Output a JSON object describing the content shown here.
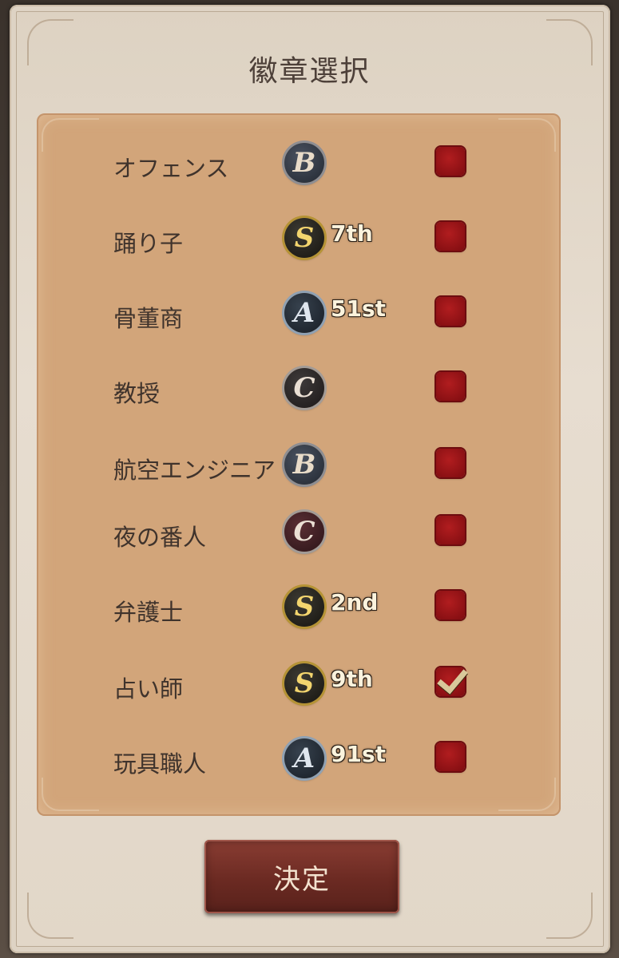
{
  "dialog": {
    "title": "徽章選択",
    "confirm_label": "決定"
  },
  "rows": [
    {
      "label": "オフェンス",
      "badge": "B",
      "badge_tier": "b",
      "rank": "",
      "checked": false
    },
    {
      "label": "踊り子",
      "badge": "S",
      "badge_tier": "s",
      "rank": "7th",
      "checked": false
    },
    {
      "label": "骨董商",
      "badge": "A",
      "badge_tier": "a",
      "rank": "51st",
      "checked": false
    },
    {
      "label": "教授",
      "badge": "C",
      "badge_tier": "c",
      "rank": "",
      "checked": false
    },
    {
      "label": "航空エンジニア",
      "badge": "B",
      "badge_tier": "b",
      "rank": "",
      "checked": false
    },
    {
      "label": "夜の番人",
      "badge": "C",
      "badge_tier": "c-red",
      "rank": "",
      "checked": false
    },
    {
      "label": "弁護士",
      "badge": "S",
      "badge_tier": "s",
      "rank": "2nd",
      "checked": false
    },
    {
      "label": "占い師",
      "badge": "S",
      "badge_tier": "s",
      "rank": "9th",
      "checked": true
    },
    {
      "label": "玩具職人",
      "badge": "A",
      "badge_tier": "a",
      "rank": "91st",
      "checked": false
    }
  ],
  "colors": {
    "panel": "#d2a57a",
    "checkbox_red": "#9e1519",
    "button": "#6b2a22"
  }
}
